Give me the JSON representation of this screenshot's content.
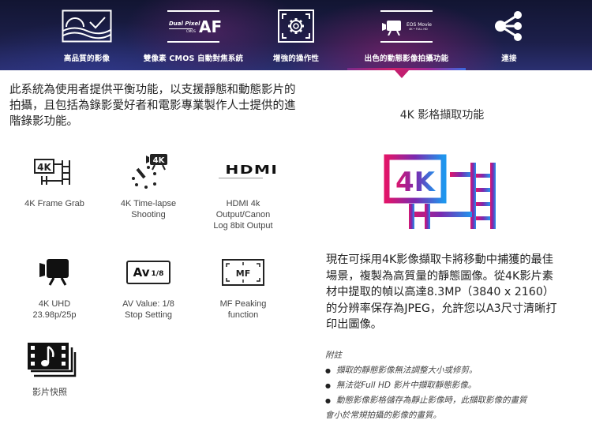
{
  "nav": {
    "items": [
      {
        "label": "高品質的影像",
        "icon": "landscape-check-icon"
      },
      {
        "label": "雙像素 CMOS 自動對焦系統",
        "icon": "dual-pixel-af-icon",
        "logo_text": "Dual Pixel",
        "logo_sub": "CMOS",
        "logo_af": "AF"
      },
      {
        "label": "增強的操作性",
        "icon": "gear-frame-icon"
      },
      {
        "label": "出色的動態影像拍攝功能",
        "icon": "eos-movie-icon",
        "logo_text": "EOS Movie",
        "logo_sub": "4K • FULL HD",
        "active": true
      },
      {
        "label": "連接",
        "icon": "share-icon"
      }
    ]
  },
  "intro": "此系統為使用者提供平衡功能，以支援靜態和動態影片的拍攝，且包括為錄影愛好者和電影專業製作人士提供的進階錄影功能。",
  "features": [
    {
      "label": "4K Frame Grab",
      "icon": "4k-frame-grab-icon"
    },
    {
      "label": "4K Time-lapse Shooting",
      "icon": "4k-timelapse-icon"
    },
    {
      "label": "HDMI 4k Output/Canon Log 8bit Output",
      "icon": "hdmi-icon",
      "icon_text": "HDMI"
    },
    {
      "label": "4K UHD 23.98p/25p",
      "icon": "video-camera-icon"
    },
    {
      "label": "AV Value: 1/8 Stop Setting",
      "icon": "av-value-icon",
      "icon_text": "Av",
      "icon_sub": "1/8"
    },
    {
      "label": "MF Peaking function",
      "icon": "mf-peaking-icon",
      "icon_text": "MF"
    },
    {
      "label": "影片快照",
      "icon": "video-snapshot-icon"
    }
  ],
  "detail": {
    "title": "4K 影格擷取功能",
    "image_text": "4K",
    "description": "現在可採用4K影像擷取卡將移動中捕獲的最佳場景，複製為高質量的靜態圖像。從4K影片素材中提取的幀以高達8.3MP（3840 x 2160）的分辨率保存為JPEG，允許您以A3尺寸清晰打印出圖像。",
    "notes_title": "附註",
    "notes": [
      "擷取的靜態影像無法調整大小或修剪。",
      "無法從Full HD 影片中擷取靜態影像。",
      "動態影像影格儲存為靜止影像時，此擷取影像的畫質"
    ],
    "notes_cont": "會小於常規拍攝的影像的畫質。"
  },
  "colors": {
    "accent_pink": "#c21e6f",
    "accent_blue": "#2a8ae8",
    "nav_bg": "#1c1f4a"
  }
}
